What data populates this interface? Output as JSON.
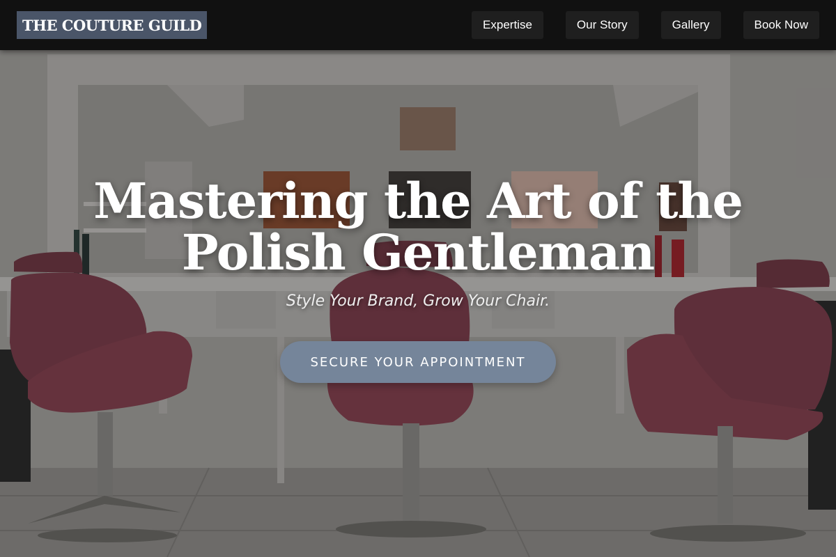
{
  "header": {
    "logo": "THE COUTURE GUILD",
    "nav": [
      {
        "label": "Expertise"
      },
      {
        "label": "Our Story"
      },
      {
        "label": "Gallery"
      },
      {
        "label": "Book Now"
      }
    ]
  },
  "hero": {
    "headline_line1": "Mastering the Art of the",
    "headline_line2": "Polish Gentleman",
    "tagline": "Style Your Brand, Grow Your Chair.",
    "cta_label": "SECURE YOUR APPOINTMENT"
  },
  "colors": {
    "header_bg": "#111111",
    "logo_bg": "#4a5568",
    "cta_bg": "#75859a",
    "chair": "#7a3a48"
  }
}
